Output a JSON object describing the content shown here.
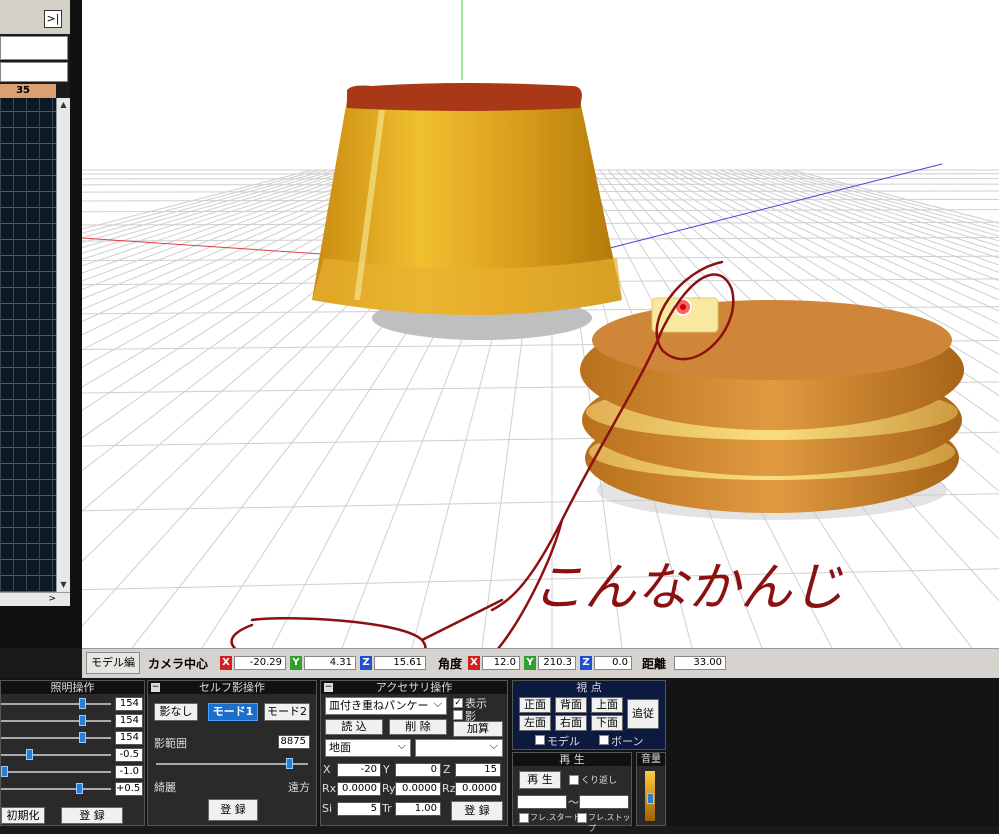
{
  "timeline": {
    "collapse_label": ">|",
    "frame_header": "35"
  },
  "camera_bar": {
    "model_edit_button": "モデル編",
    "camera_center_label": "カメラ中心",
    "x_label": "X",
    "y_label": "Y",
    "z_label": "Z",
    "cx": "-20.29",
    "cy": "4.31",
    "cz": "15.61",
    "angle_label": "角度",
    "ax": "12.0",
    "ay": "210.3",
    "az": "0.0",
    "distance_label": "距離",
    "distance": "33.00"
  },
  "lighting": {
    "title": "照明操作",
    "values": [
      "154",
      "154",
      "154",
      "-0.5",
      "-1.0",
      "+0.5"
    ],
    "levels": [
      0.78,
      0.78,
      0.78,
      0.25,
      0.0,
      0.75
    ],
    "reset_button": "初期化",
    "register_button": "登 録"
  },
  "self_shadow": {
    "title": "セルフ影操作",
    "none_button": "影なし",
    "mode1_button": "モード1",
    "mode2_button": "モード2",
    "range_label": "影範囲",
    "range_value": "8875",
    "range_level": 0.88,
    "fine_label": "綺麗",
    "far_label": "遠方",
    "register_button": "登 録"
  },
  "accessory": {
    "title": "アクセサリ操作",
    "model_select": "皿付き重ねパンケー",
    "show_label": "表示",
    "shadow_label": "影",
    "add_label": "加算",
    "load_button": "読 込",
    "delete_button": "削 除",
    "parent_select": "地面",
    "bone_select": "",
    "x_label": "X",
    "y_label": "Y",
    "z_label": "Z",
    "x": "-20",
    "y": "0",
    "z": "15",
    "rx_label": "Rx",
    "ry_label": "Ry",
    "rz_label": "Rz",
    "rx": "0.0000",
    "ry": "0.0000",
    "rz": "0.0000",
    "si_label": "Si",
    "tr_label": "Tr",
    "si": "5",
    "tr": "1.00",
    "register_button": "登 録"
  },
  "viewpoint": {
    "title": "視 点",
    "front": "正面",
    "back": "背面",
    "top": "上面",
    "left": "左面",
    "right": "右面",
    "bottom": "下面",
    "follow": "追従",
    "model_label": "モデル",
    "bone_label": "ボーン"
  },
  "playback": {
    "title": "再 生",
    "play_button": "再 生",
    "repeat_label": "くり返し",
    "range_sep": "～",
    "frame_start_label": "フレ.スタート",
    "frame_stop_label": "フレ.ストップ"
  },
  "volume": {
    "title": "音量",
    "level": 0.45
  },
  "annotation": {
    "handwritten_text": "こんなかんじ"
  },
  "colors": {
    "annotation": "#8b1010",
    "timeline_header": "#d9a070",
    "accent_blue": "#1a6ecc"
  }
}
